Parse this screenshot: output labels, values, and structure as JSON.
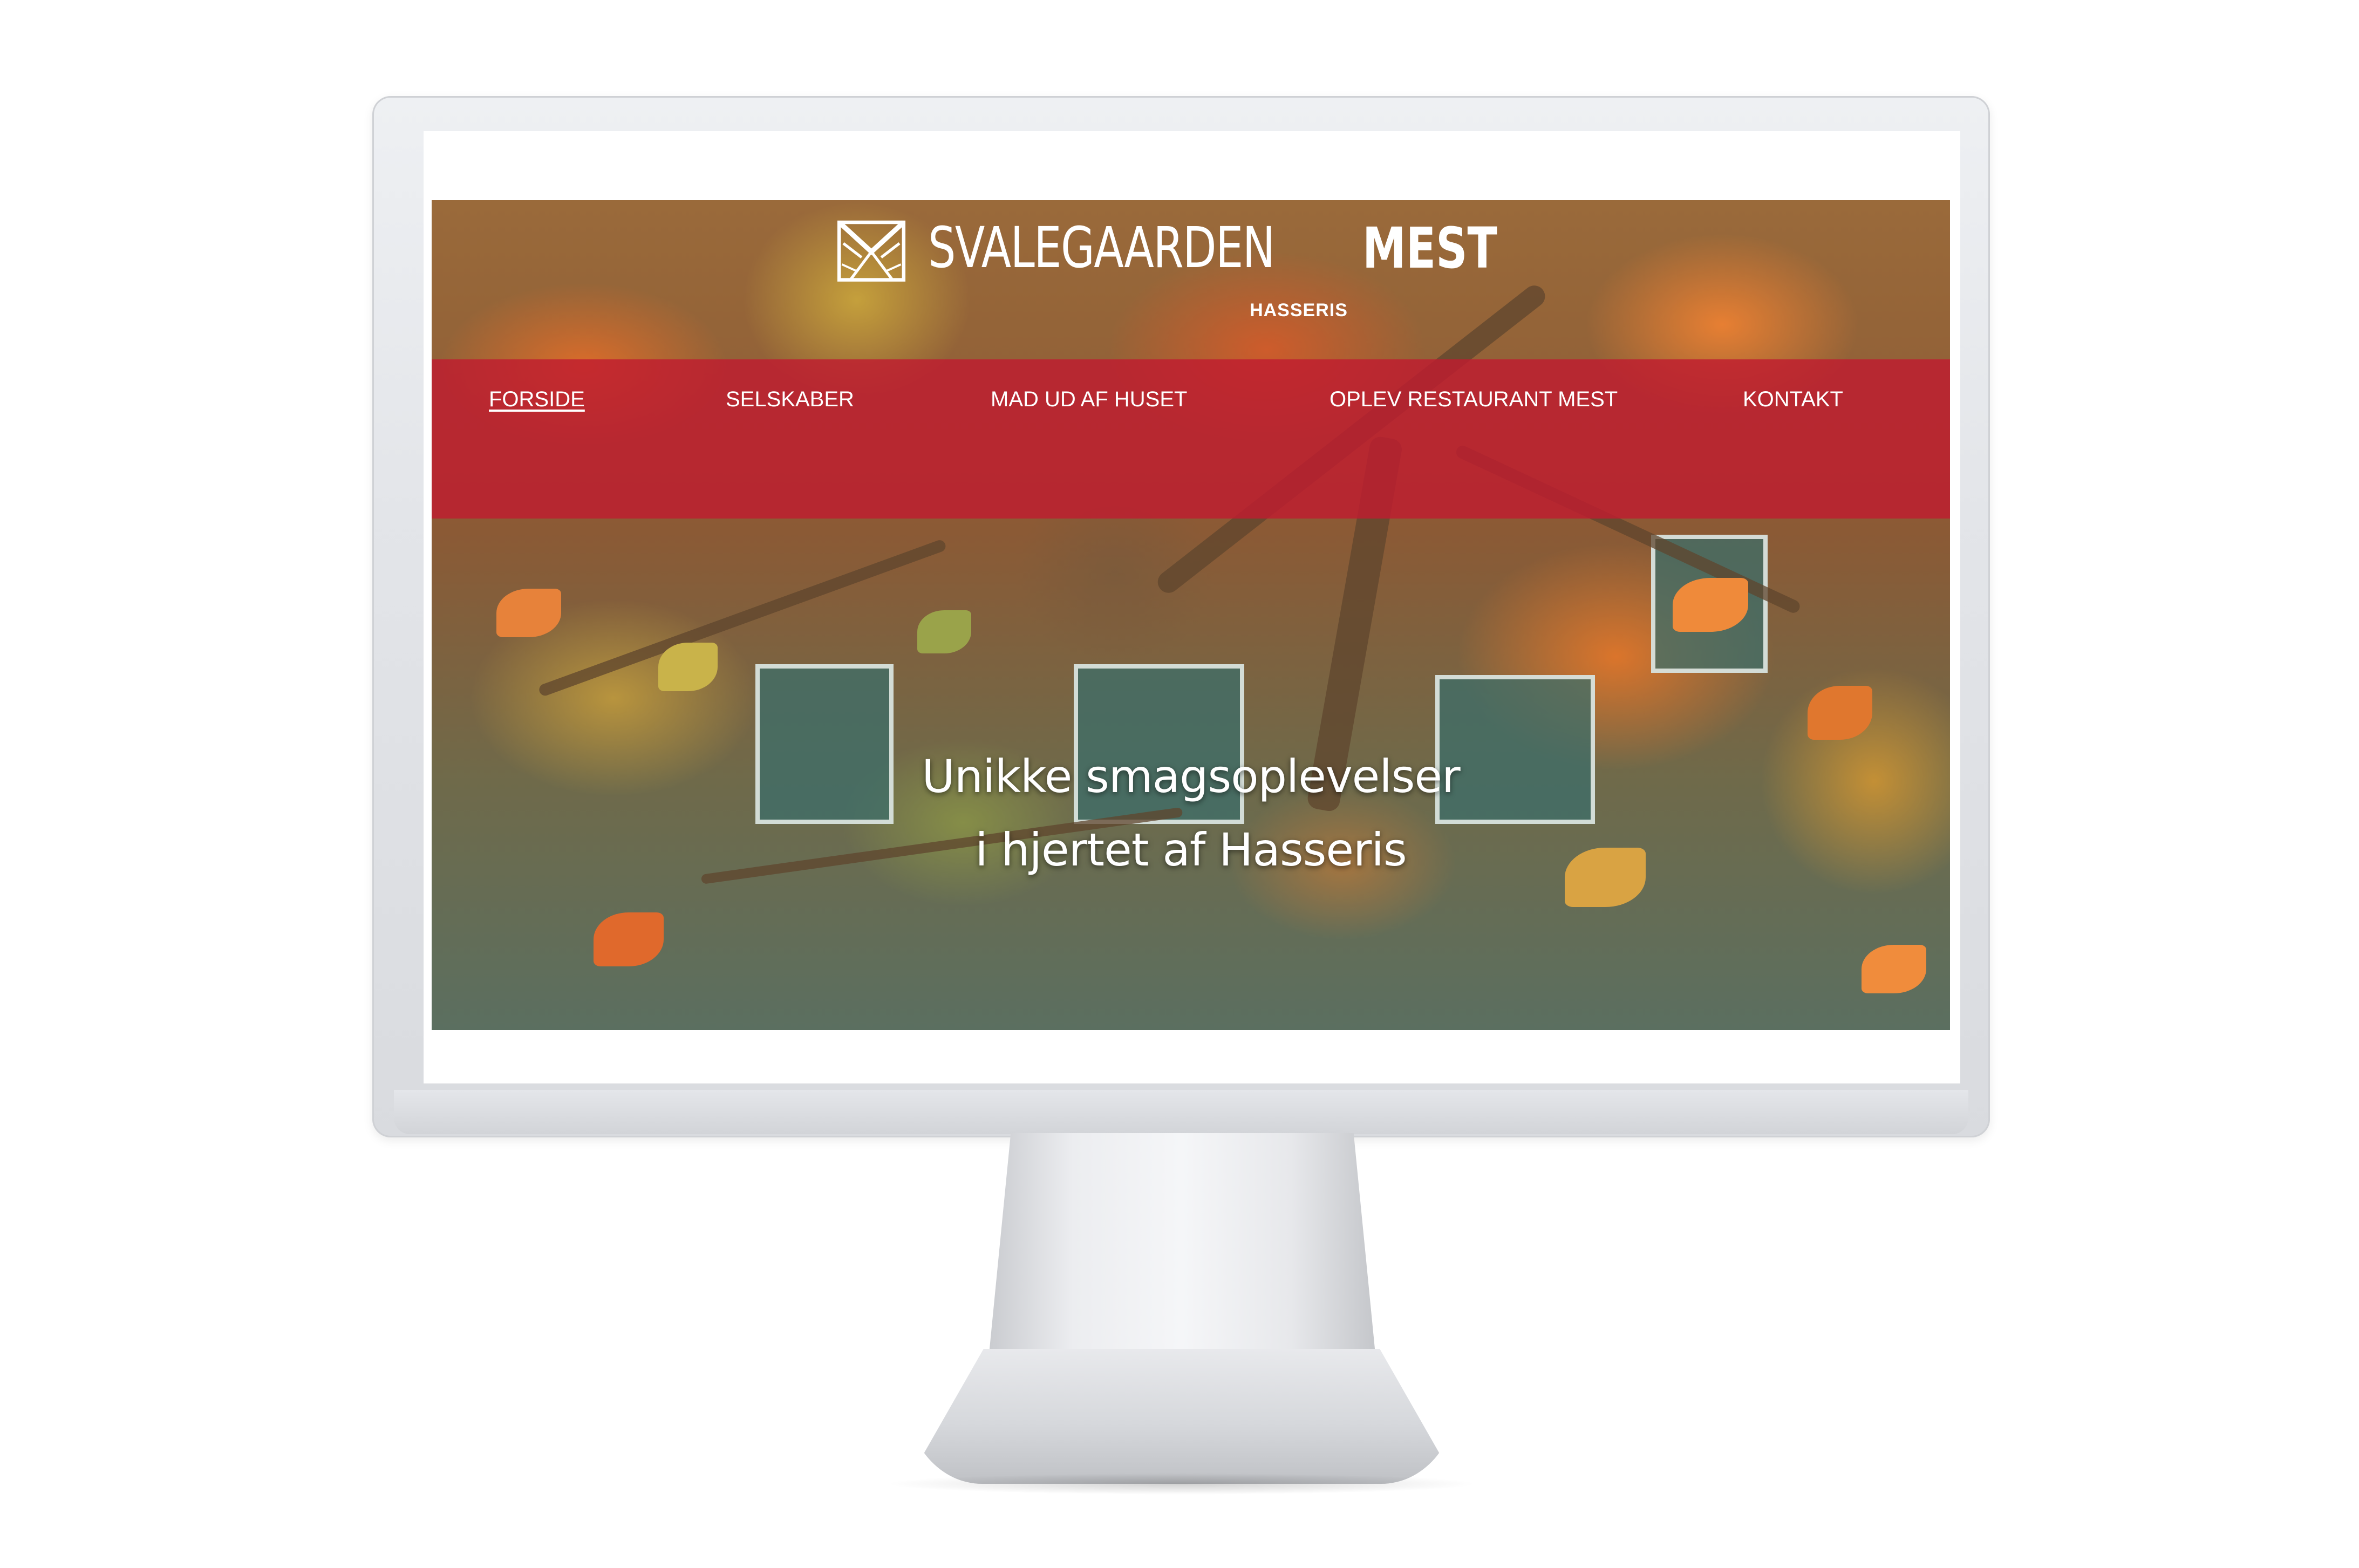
{
  "site": {
    "logo": {
      "name_light": "SVALEGAARDEN",
      "name_bold": "MEST",
      "subtitle": "HASSERIS"
    },
    "nav": {
      "items": [
        {
          "label": "FORSIDE",
          "active": true
        },
        {
          "label": "SELSKABER",
          "active": false
        },
        {
          "label": "MAD UD AF HUSET",
          "active": false
        },
        {
          "label": "OPLEV RESTAURANT MEST",
          "active": false
        },
        {
          "label": "KONTAKT",
          "active": false
        }
      ]
    },
    "hero": {
      "line1": "Unikke smagsoplevelser",
      "line2": "i hjertet af Hasseris"
    }
  },
  "colors": {
    "nav_bar": "#c01c30",
    "text": "#ffffff",
    "monitor": "#e3e5e9"
  }
}
